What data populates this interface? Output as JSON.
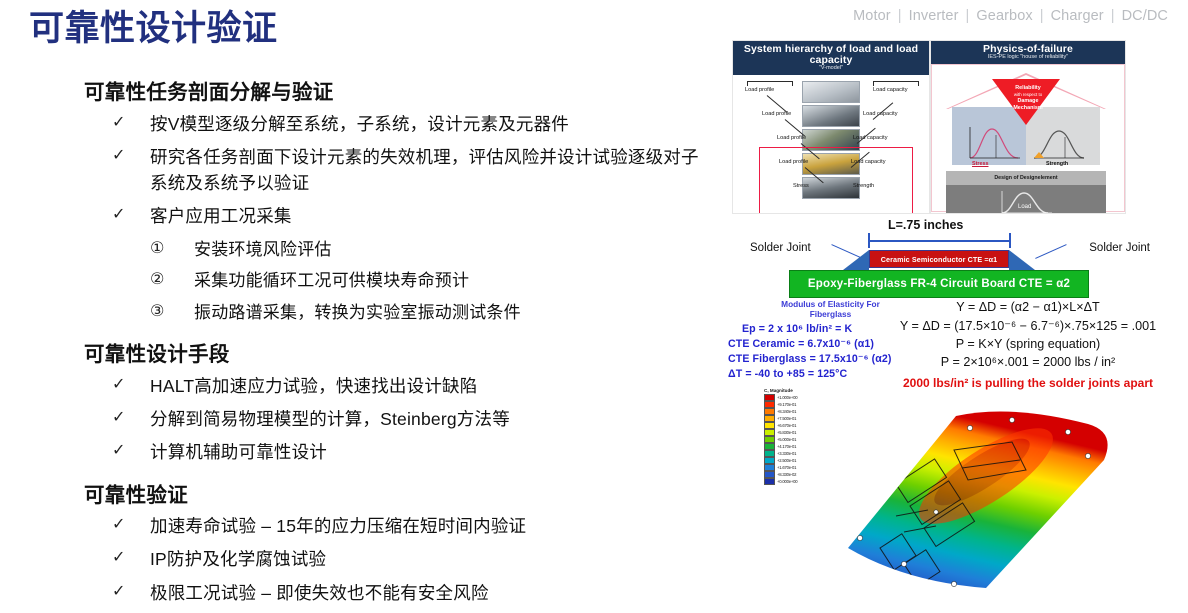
{
  "slide": {
    "title": "可靠性设计验证",
    "title_color": "#21307f",
    "background": "#ffffff"
  },
  "topnav": {
    "separator": "|",
    "items": [
      "Motor",
      "Inverter",
      "Gearbox",
      "Charger",
      "DC/DC"
    ],
    "color": "#b9bcc0"
  },
  "content": {
    "sections": [
      {
        "heading": "可靠性任务剖面分解与验证",
        "items": [
          {
            "marker": "✓",
            "text": "按V模型逐级分解至系统，子系统，设计元素及元器件"
          },
          {
            "marker": "✓",
            "text": "研究各任务剖面下设计元素的失效机理，评估风险并设计试验逐级对子系统及系统予以验证"
          },
          {
            "marker": "✓",
            "text": "客户应用工况采集"
          }
        ],
        "subitems": [
          {
            "marker": "①",
            "text": "安装环境风险评估"
          },
          {
            "marker": "②",
            "text": "采集功能循环工况可供模块寿命预计"
          },
          {
            "marker": "③",
            "text": "振动路谱采集，转换为实验室振动测试条件"
          }
        ]
      },
      {
        "heading": "可靠性设计手段",
        "items": [
          {
            "marker": "✓",
            "text": "HALT高加速应力试验，快速找出设计缺陷"
          },
          {
            "marker": "✓",
            "text": "分解到简易物理模型的计算，Steinberg方法等"
          },
          {
            "marker": "✓",
            "text": "计算机辅助可靠性设计"
          }
        ],
        "subitems": []
      },
      {
        "heading": "可靠性验证",
        "items": [
          {
            "marker": "✓",
            "text": "加速寿命试验 – 15年的应力压缩在短时间内验证"
          },
          {
            "marker": "✓",
            "text": "IP防护及化学腐蚀试验"
          },
          {
            "marker": "✓",
            "text": "极限工况试验 – 即使失效也不能有安全风险"
          }
        ],
        "subitems": []
      }
    ]
  },
  "artwork": {
    "vmodel": {
      "title": "System hierarchy of load and load capacity",
      "subtitle": "\"V-model\"",
      "header_color": "#1c3557",
      "labels_left": [
        "Load profile",
        "Load profile",
        "Load profile",
        "Load profile",
        "Stress"
      ],
      "labels_right": [
        "Load capacity",
        "Load capacity",
        "Load capacity",
        "Load capacity",
        "Strength"
      ]
    },
    "physics": {
      "title": "Physics-of-failure",
      "subtitle": "IES-PE logic \"house of reliability\"",
      "header_color": "#1c3557",
      "roof_label": "Reliability",
      "roof_label2": "with respect to",
      "roof_label3": "Damage",
      "roof_label4": "Mechanism",
      "left_band": "Stress",
      "right_band": "Strength",
      "mid_band": "Design of Designelement",
      "bottom_band": "Load"
    },
    "solder": {
      "length_label": "L=.75 inches",
      "joint_left": "Solder Joint",
      "joint_right": "Solder Joint",
      "chip_label": "Ceramic Semiconductor CTE =α1",
      "board_label": "Epoxy-Fiberglass FR-4 Circuit Board CTE = α2",
      "chip_color": "#c81111",
      "board_color": "#12b522",
      "fillet_color": "#2f68b5"
    },
    "equations_left": {
      "caption_line1": "Modulus of Elasticity For",
      "caption_line2": "Fiberglass",
      "lines": [
        "Ep = 2 x 10⁶ lb/in² = K",
        "CTE Ceramic = 6.7x10⁻⁶ (α1)",
        "CTE Fiberglass = 17.5x10⁻⁶ (α2)",
        "ΔT = -40 to +85 = 125°C"
      ],
      "color": "#2323cf"
    },
    "equations_right": {
      "line1": "Y = ΔD = (α2 − α1)×L×ΔT",
      "line2": "Y = ΔD = (17.5×10⁻⁶ − 6.7⁻⁶)×.75×125 = .001",
      "line3": "P = K×Y  (spring equation)",
      "line4": "P = 2×10⁶×.001 = 2000 lbs / in²",
      "conclusion": "2000 lbs/in² is pulling the solder joints apart",
      "conclusion_color": "#e01010"
    },
    "fea": {
      "legend_title": "C, Magnitude",
      "legend_values": [
        "+1.000e+00",
        "+9.170e-01",
        "+8.340e-01",
        "+7.500e-01",
        "+6.670e-01",
        "+5.830e-01",
        "+5.000e-01",
        "+4.170e-01",
        "+3.330e-01",
        "+2.500e-01",
        "+1.670e-01",
        "+8.330e-02",
        "+0.000e+00"
      ],
      "legend_colors": [
        "#d40000",
        "#ff2a00",
        "#ff7a00",
        "#ffae00",
        "#ffe400",
        "#caf000",
        "#6ed000",
        "#19b33a",
        "#00b48c",
        "#00a8c8",
        "#1f7fd8",
        "#2456c8",
        "#1b2fa8"
      ]
    }
  }
}
